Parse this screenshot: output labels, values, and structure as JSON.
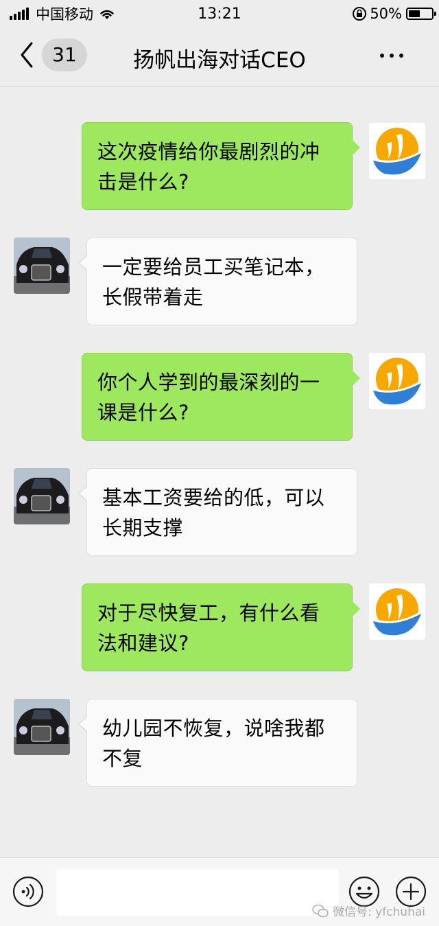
{
  "status_bar": {
    "carrier": "中国移动",
    "time": "13:21",
    "battery_percent": "50%",
    "battery_level": 0.5
  },
  "nav": {
    "back_icon": "chevron-left-icon",
    "unread_count": "31",
    "title": "扬帆出海对话CEO",
    "more_icon": "more-dots-icon"
  },
  "messages": [
    {
      "side": "right",
      "sender": "host",
      "text": "这次疫情给你最剧烈的冲击是什么?"
    },
    {
      "side": "left",
      "sender": "ceo",
      "text": "一定要给员工买笔记本，长假带着走"
    },
    {
      "side": "right",
      "sender": "host",
      "text": "你个人学到的最深刻的一课是什么?"
    },
    {
      "side": "left",
      "sender": "ceo",
      "text": "基本工资要给的低，可以长期支撑"
    },
    {
      "side": "right",
      "sender": "host",
      "text": "对于尽快复工，有什么看法和建议?"
    },
    {
      "side": "left",
      "sender": "ceo",
      "text": "幼儿园不恢复，说啥我都不复"
    }
  ],
  "input_bar": {
    "voice_icon": "voice-icon",
    "text_value": "",
    "emoji_icon": "emoji-icon",
    "plus_icon": "plus-icon",
    "watermark": "微信号: yfchuhai"
  },
  "colors": {
    "background": "#ededed",
    "bubble_sent": "#9ee85f",
    "bubble_received": "#fafafa",
    "logo_orange": "#f6a800",
    "logo_blue": "#2f7fd6"
  }
}
